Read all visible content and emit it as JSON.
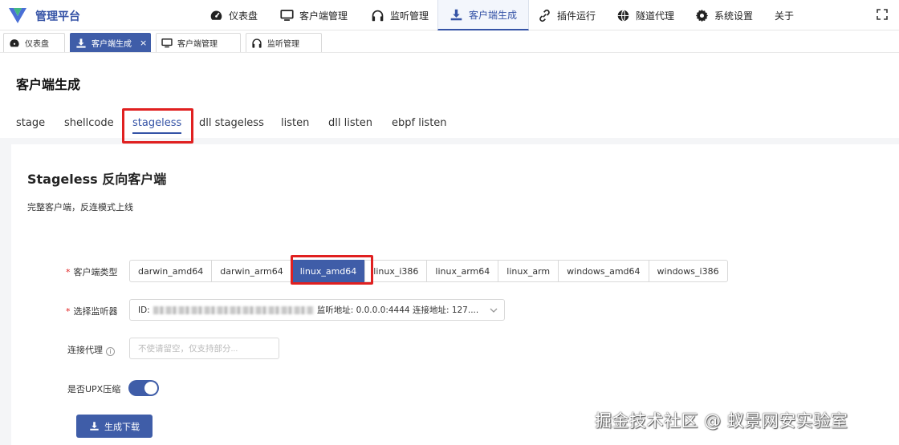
{
  "app": {
    "brand": "管理平台"
  },
  "nav": [
    {
      "label": "仪表盘",
      "icon": "dashboard-icon"
    },
    {
      "label": "客户端管理",
      "icon": "monitor-icon"
    },
    {
      "label": "监听管理",
      "icon": "headphones-icon"
    },
    {
      "label": "客户端生成",
      "icon": "download-icon",
      "active": true
    },
    {
      "label": "插件运行",
      "icon": "link-icon"
    },
    {
      "label": "隧道代理",
      "icon": "globe-icon"
    },
    {
      "label": "系统设置",
      "icon": "gear-icon"
    },
    {
      "label": "关于",
      "icon": ""
    }
  ],
  "tabs": [
    {
      "label": "仪表盘",
      "icon": "dashboard-icon"
    },
    {
      "label": "客户端生成",
      "icon": "download-icon",
      "active": true,
      "close": "×"
    },
    {
      "label": "客户端管理",
      "icon": "monitor-icon"
    },
    {
      "label": "监听管理",
      "icon": "headphones-icon"
    }
  ],
  "page": {
    "title": "客户端生成"
  },
  "subtabs": [
    "stage",
    "shellcode",
    "stageless",
    "dll stageless",
    "listen",
    "dll listen",
    "ebpf listen"
  ],
  "subtab_active": "stageless",
  "card": {
    "title": "Stageless 反向客户端",
    "desc": "完整客户端，反连模式上线"
  },
  "form": {
    "client_type_label": "客户端类型",
    "client_types": [
      "darwin_amd64",
      "darwin_arm64",
      "linux_amd64",
      "linux_i386",
      "linux_arm64",
      "linux_arm",
      "windows_amd64",
      "windows_i386"
    ],
    "client_type_selected": "linux_amd64",
    "listener_label": "选择监听器",
    "listener_prefix": "ID: ",
    "listener_suffix": "监听地址: 0.0.0.0:4444 连接地址: 127....",
    "proxy_label": "连接代理",
    "proxy_placeholder": "不使请留空，仅支持部分...",
    "upx_label": "是否UPX压缩",
    "upx_enabled": true,
    "required_mark": "*",
    "info_mark": "i",
    "generate_button": "生成下载"
  },
  "watermark": "掘金技术社区 @ 蚁景网安实验室",
  "colors": {
    "primary": "#3f5da8",
    "highlight": "#e02020"
  }
}
